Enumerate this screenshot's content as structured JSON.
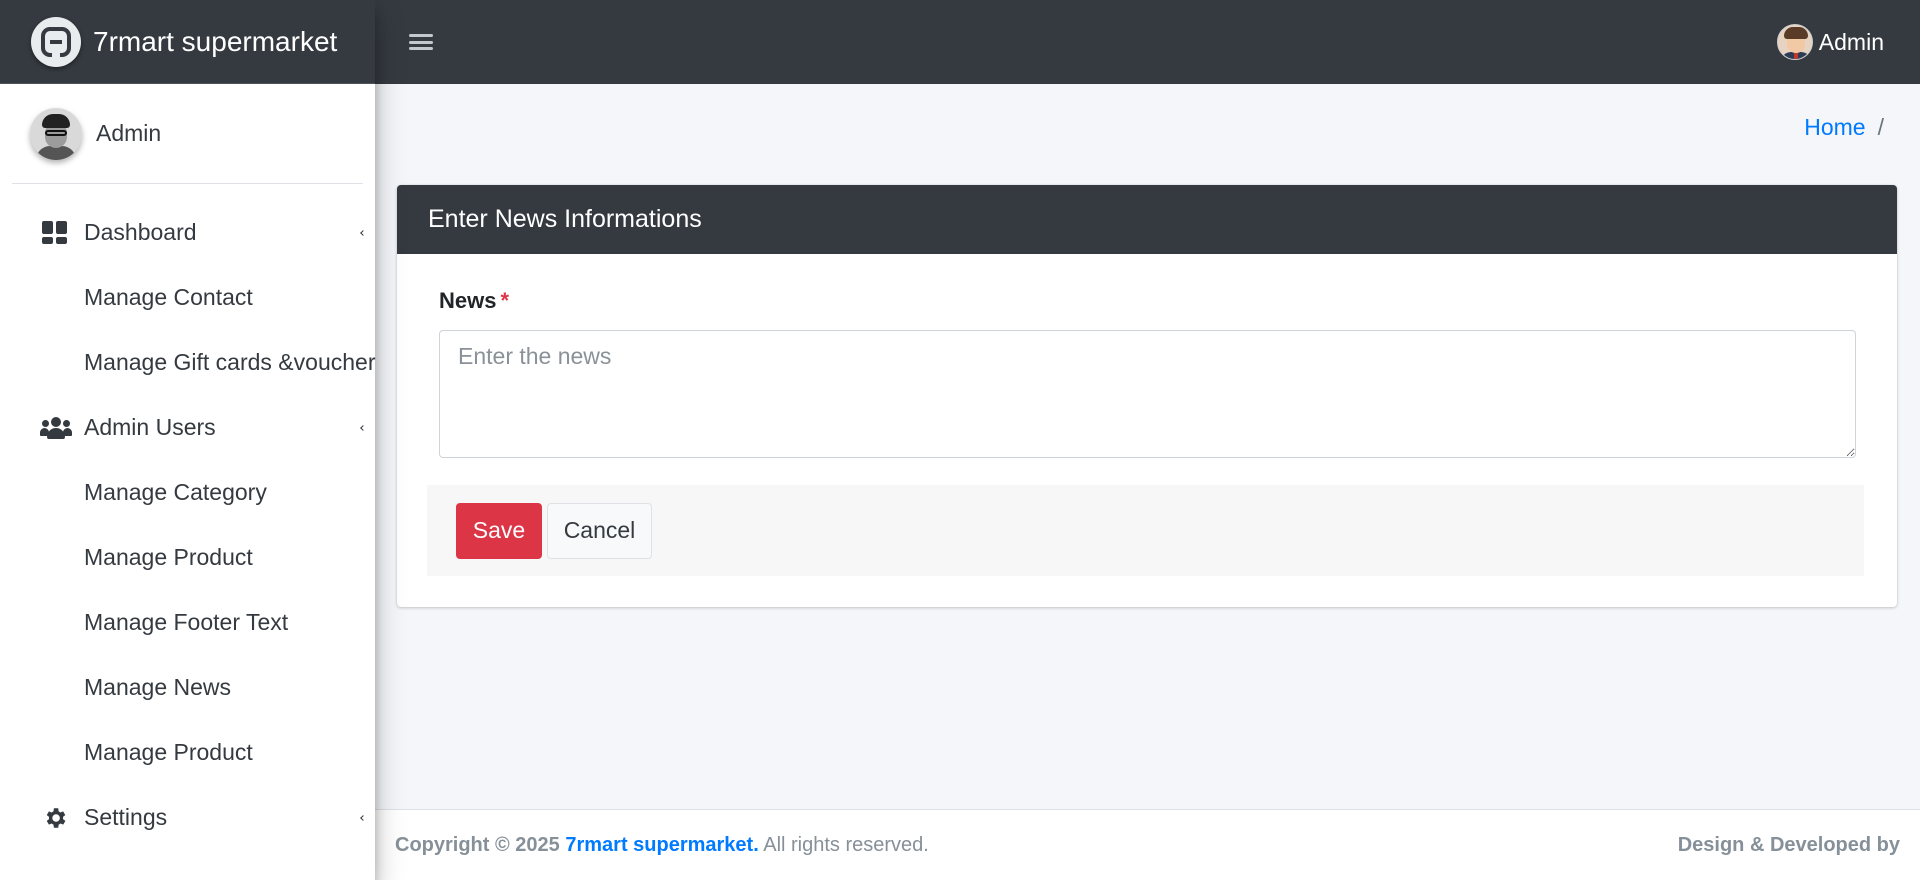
{
  "brand": {
    "name": "7rmart supermarket",
    "logo_icon": "brand-logo-icon"
  },
  "topbar": {
    "menu_icon": "hamburger-icon",
    "user_name": "Admin"
  },
  "sidebar": {
    "user_name": "Admin",
    "items": [
      {
        "label": "Dashboard",
        "icon": "dashboard-icon",
        "has_caret": true
      },
      {
        "label": "Manage Contact"
      },
      {
        "label": "Manage Gift cards &voucher"
      },
      {
        "label": "Admin Users",
        "icon": "users-icon",
        "has_caret": true
      },
      {
        "label": "Manage Category"
      },
      {
        "label": "Manage Product"
      },
      {
        "label": "Manage Footer Text"
      },
      {
        "label": "Manage News"
      },
      {
        "label": "Manage Product"
      },
      {
        "label": "Settings",
        "icon": "gear-icon",
        "has_caret": true
      }
    ]
  },
  "breadcrumb": {
    "home": "Home",
    "separator": "/"
  },
  "card": {
    "title": "Enter News Informations",
    "field_label": "News",
    "required_mark": "*",
    "textarea_placeholder": "Enter the news",
    "textarea_value": "",
    "save_label": "Save",
    "cancel_label": "Cancel"
  },
  "footer": {
    "copyright_prefix": "Copyright © 2025",
    "brand_link": "7rmart supermarket.",
    "rights": "All rights reserved.",
    "credit": "Design & Developed by"
  },
  "colors": {
    "dark": "#343a40",
    "primary": "#007bff",
    "danger": "#dc3545",
    "content_bg": "#f4f6f9"
  }
}
